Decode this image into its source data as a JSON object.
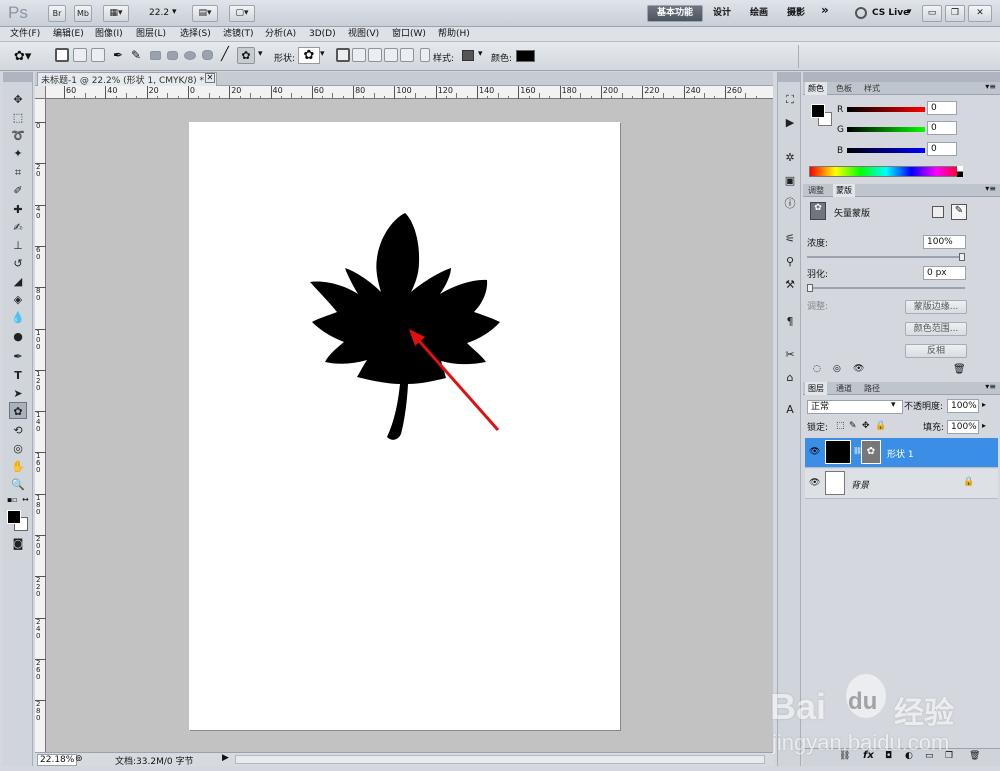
{
  "titlebar": {
    "ps_logo": "Ps",
    "br_label": "Br",
    "mb_label": "Mb",
    "zoom_value": "22.2",
    "workspaces": [
      "基本功能",
      "设计",
      "绘画",
      "摄影"
    ],
    "more": "»",
    "cslive": "CS Live"
  },
  "menu": [
    "文件(F)",
    "编辑(E)",
    "图像(I)",
    "图层(L)",
    "选择(S)",
    "滤镜(T)",
    "分析(A)",
    "3D(D)",
    "视图(V)",
    "窗口(W)",
    "帮助(H)"
  ],
  "options": {
    "shape_label": "形状:",
    "style_label": "样式:",
    "color_label": "颜色:",
    "color": "#000000"
  },
  "document": {
    "tab_title": "未标题-1 @ 22.2% (形状 1, CMYK/8) *",
    "ruler_top": [
      "60",
      "40",
      "20",
      "0",
      "20",
      "40",
      "60",
      "80",
      "100",
      "120",
      "140",
      "160",
      "180",
      "200",
      "220",
      "240",
      "260"
    ],
    "ruler_left": [
      "0",
      "2\n0",
      "4\n0",
      "6\n0",
      "8\n0",
      "1\n0\n0",
      "1\n2\n0",
      "1\n4\n0",
      "1\n6\n0",
      "1\n8\n0",
      "2\n0\n0",
      "2\n2\n0",
      "2\n4\n0",
      "2\n6\n0",
      "2\n8\n0"
    ],
    "status_zoom": "22.18%",
    "status_doc": "文档:33.2M/0 字节"
  },
  "panels": {
    "color": {
      "tabs": [
        "颜色",
        "色板",
        "样式"
      ],
      "r_label": "R",
      "g_label": "G",
      "b_label": "B",
      "r_value": "0",
      "g_value": "0",
      "b_value": "0"
    },
    "masks": {
      "tabs": [
        "调整",
        "蒙版"
      ],
      "title": "矢量蒙版",
      "density_label": "浓度:",
      "density_value": "100%",
      "feather_label": "羽化:",
      "feather_value": "0 px",
      "refine_label": "调整:",
      "btn_edge": "蒙版边缘...",
      "btn_color_range": "颜色范围...",
      "btn_invert": "反相"
    },
    "layers": {
      "tabs": [
        "图层",
        "通道",
        "路径"
      ],
      "blend_mode": "正常",
      "opacity_label": "不透明度:",
      "opacity_value": "100%",
      "lock_label": "锁定:",
      "fill_label": "填充:",
      "fill_value": "100%",
      "items": [
        {
          "name": "形状 1"
        },
        {
          "name": "背景"
        }
      ]
    }
  },
  "watermark": {
    "brand": "Bai",
    "brand2": "du",
    "brand_cn": "经验",
    "url": "jingyan.baidu.com"
  },
  "colors": {
    "accent_selected": "#3a8ee6",
    "annotation_arrow": "#e01010",
    "leaf": "#000000"
  }
}
